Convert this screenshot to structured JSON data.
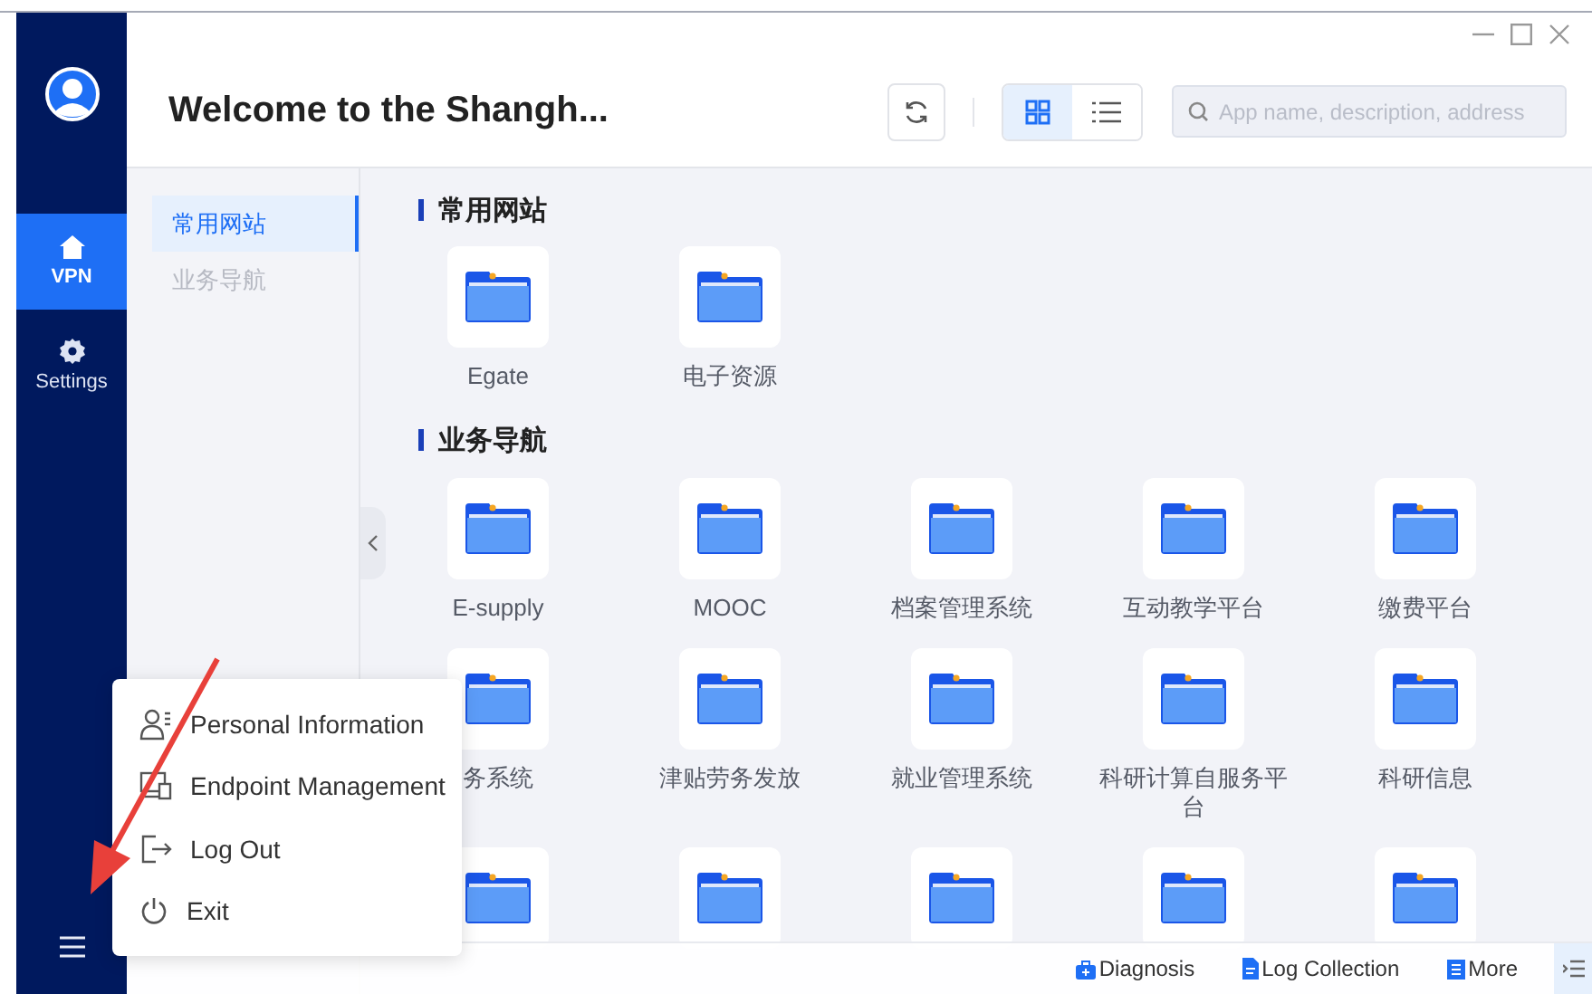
{
  "window": {
    "title": "Welcome to the Shangh..."
  },
  "sidebar": {
    "items": [
      {
        "label": "VPN",
        "selected": true
      },
      {
        "label": "Settings",
        "selected": false
      }
    ]
  },
  "toolbar": {
    "views": [
      {
        "selected": true
      },
      {
        "selected": false
      }
    ]
  },
  "search": {
    "placeholder": "App name, description, address"
  },
  "nav": {
    "items": [
      {
        "label": "常用网站",
        "selected": true
      },
      {
        "label": "业务导航",
        "selected": false
      }
    ]
  },
  "sections": [
    {
      "title": "常用网站",
      "apps": [
        {
          "kind": "folder",
          "label": "Egate"
        },
        {
          "kind": "folder",
          "label": "电子资源"
        }
      ]
    },
    {
      "title": "业务导航",
      "apps": [
        {
          "kind": "folder",
          "label": "E-supply"
        },
        {
          "kind": "folder",
          "label": "MOOC"
        },
        {
          "kind": "folder",
          "label": "档案管理系统"
        },
        {
          "kind": "folder",
          "label": "互动教学平台"
        },
        {
          "kind": "folder",
          "label": "缴费平台"
        },
        {
          "kind": "folder",
          "label": "务系统"
        },
        {
          "kind": "folder",
          "label": "津贴劳务发放"
        },
        {
          "kind": "folder",
          "label": "就业管理系统"
        },
        {
          "kind": "folder",
          "label": "科研计算自服务平台"
        },
        {
          "kind": "folder",
          "label": "科研信息"
        },
        {
          "kind": "folder"
        },
        {
          "kind": "folder"
        },
        {
          "kind": "folder"
        },
        {
          "kind": "folder"
        },
        {
          "kind": "folder"
        }
      ]
    }
  ],
  "footer": {
    "links": [
      "Diagnosis",
      "Log Collection",
      "More"
    ]
  },
  "menu": {
    "items": [
      "Personal Information",
      "Endpoint Management",
      "Log Out",
      "Exit"
    ]
  }
}
